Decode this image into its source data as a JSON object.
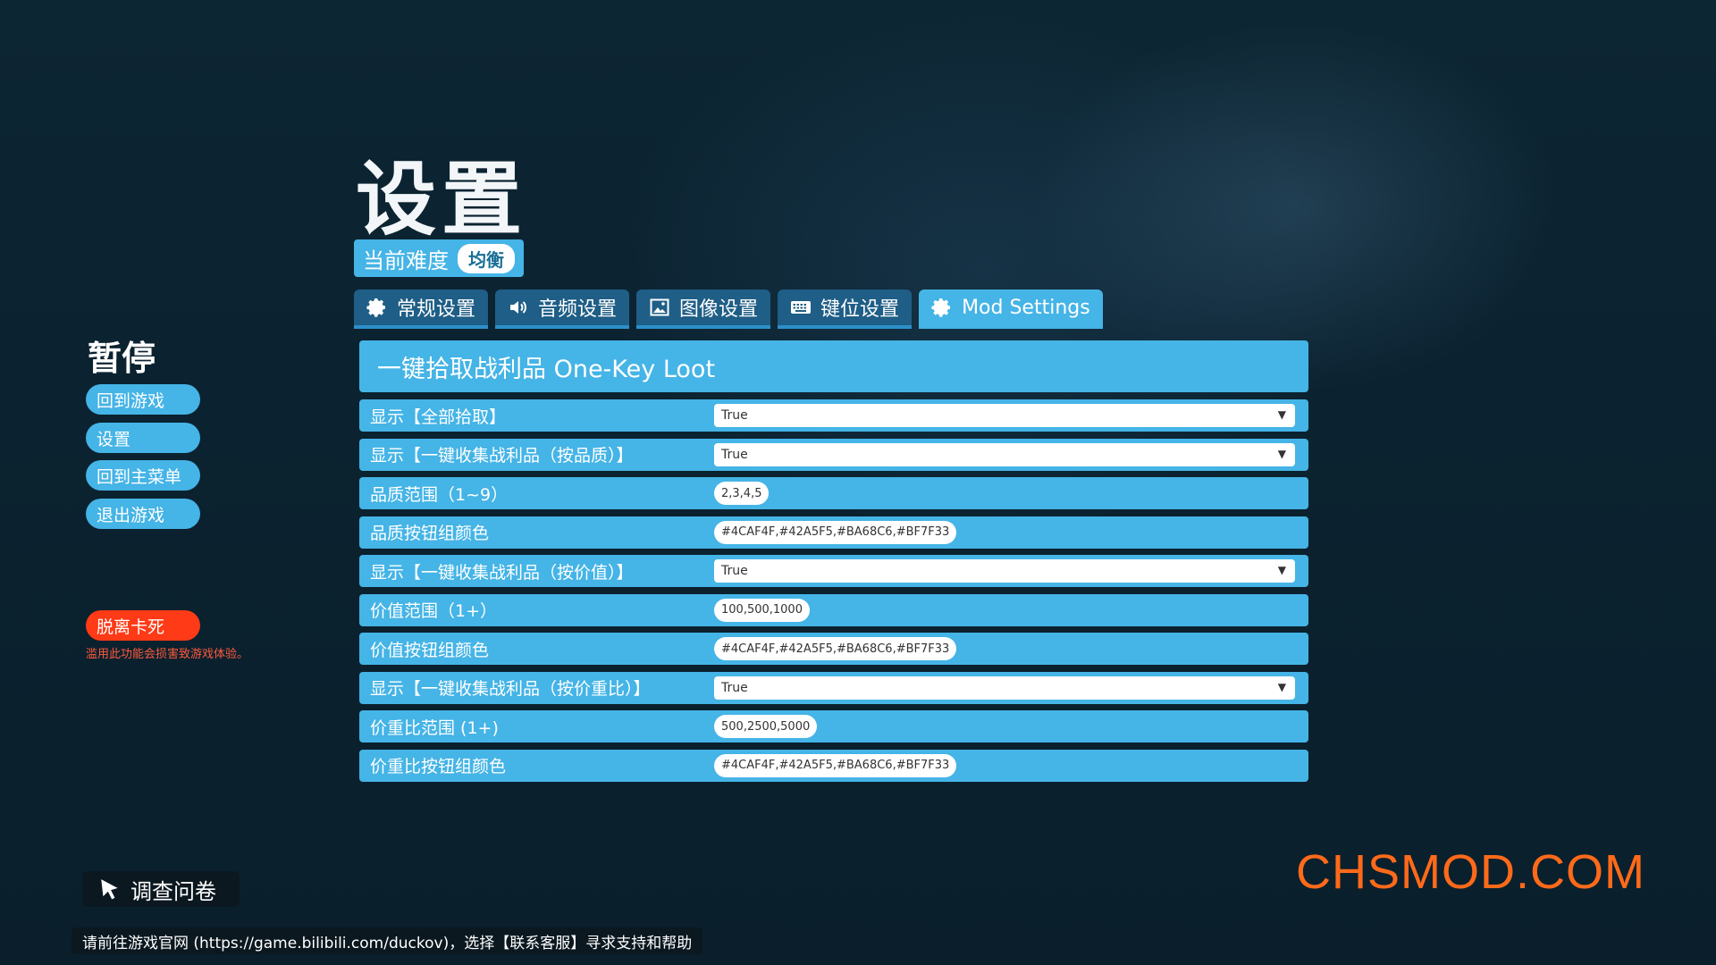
{
  "settings_title": "设置",
  "difficulty": {
    "label": "当前难度",
    "value": "均衡"
  },
  "tabs": [
    {
      "label": "常规设置",
      "icon": "gear-icon"
    },
    {
      "label": "音频设置",
      "icon": "speaker-icon"
    },
    {
      "label": "图像设置",
      "icon": "image-icon"
    },
    {
      "label": "键位设置",
      "icon": "keyboard-icon"
    },
    {
      "label": "Mod Settings",
      "icon": "gear-icon",
      "active": true
    }
  ],
  "panel": {
    "header": "一键拾取战利品 One-Key Loot",
    "rows": [
      {
        "label": "显示【全部拾取】",
        "type": "select",
        "value": "True"
      },
      {
        "label": "显示【一键收集战利品（按品质）】",
        "type": "select",
        "value": "True"
      },
      {
        "label": "品质范围（1~9）",
        "type": "text",
        "value": "2,3,4,5"
      },
      {
        "label": "品质按钮组颜色",
        "type": "text",
        "value": "#4CAF4F,#42A5F5,#BA68C6,#BF7F33"
      },
      {
        "label": "显示【一键收集战利品（按价值）】",
        "type": "select",
        "value": "True"
      },
      {
        "label": "价值范围（1+）",
        "type": "text",
        "value": "100,500,1000"
      },
      {
        "label": "价值按钮组颜色",
        "type": "text",
        "value": "#4CAF4F,#42A5F5,#BA68C6,#BF7F33"
      },
      {
        "label": "显示【一键收集战利品（按价重比）】",
        "type": "select",
        "value": "True"
      },
      {
        "label": "价重比范围 (1+)",
        "type": "text",
        "value": "500,2500,5000"
      },
      {
        "label": "价重比按钮组颜色",
        "type": "text",
        "value": "#4CAF4F,#42A5F5,#BA68C6,#BF7F33"
      }
    ]
  },
  "pause_menu": {
    "title": "暂停",
    "items": [
      "回到游戏",
      "设置",
      "回到主菜单",
      "退出游戏"
    ],
    "unstuck_label": "脱离卡死",
    "unstuck_warning": "滥用此功能会损害致游戏体验。"
  },
  "survey_label": "调查问卷",
  "footer_text": "请前往游戏官网 (https://game.bilibili.com/duckov)，选择【联系客服】寻求支持和帮助",
  "watermark": "CHSMOD.COM",
  "colors": {
    "accent": "#45b4e6",
    "tab_inactive": "#1f5e86",
    "danger": "#ff3a16",
    "watermark": "#ff6a1a"
  }
}
